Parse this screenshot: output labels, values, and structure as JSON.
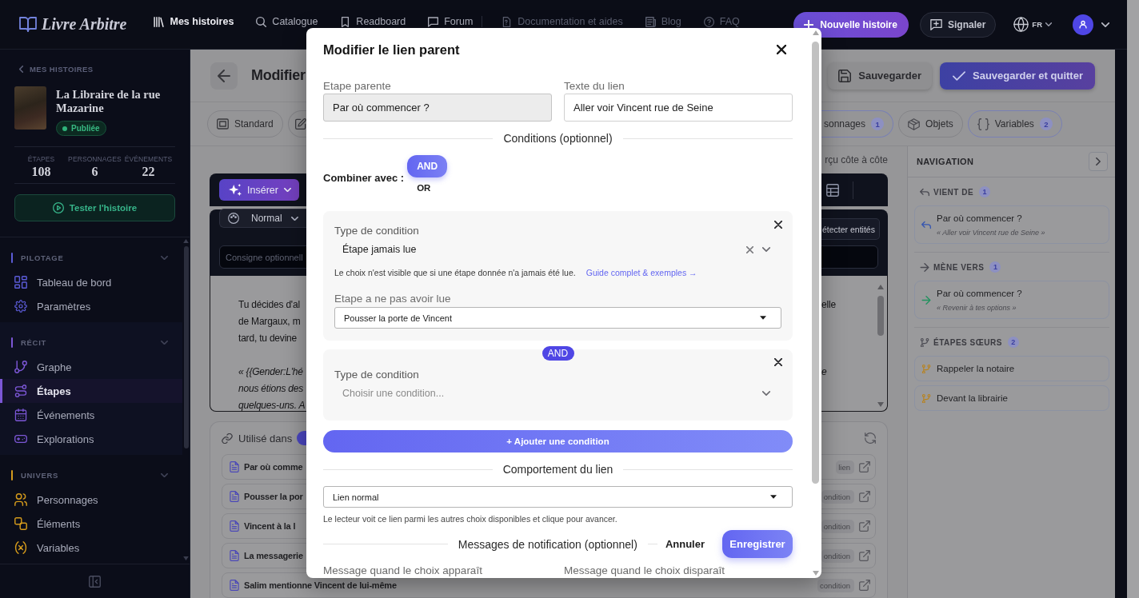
{
  "topbar": {
    "logo": "Livre Arbitre",
    "nav": [
      {
        "label": "Mes histoires",
        "kind": "main",
        "selected": true
      },
      {
        "label": "Catalogue",
        "kind": "main",
        "selected": false
      },
      {
        "label": "Readboard",
        "kind": "main",
        "selected": false
      },
      {
        "label": "Forum",
        "kind": "main",
        "selected": false
      },
      {
        "label": "Documentation et aides",
        "kind": "help",
        "selected": false
      },
      {
        "label": "Blog",
        "kind": "help",
        "selected": false
      },
      {
        "label": "FAQ",
        "kind": "help",
        "selected": false
      }
    ],
    "new_story_button": "Nouvelle histoire",
    "report_button": "Signaler",
    "language": "FR"
  },
  "sidebar": {
    "back_link": "MES HISTOIRES",
    "story_title": "La Libraire de la rue Mazarine",
    "status": "Publiée",
    "stats": [
      {
        "label": "ÉTAPES",
        "value": "108"
      },
      {
        "label": "PERSONNAGES",
        "value": "6"
      },
      {
        "label": "ÉVÉNEMENTS",
        "value": "22"
      }
    ],
    "test_button": "Tester l'histoire",
    "sections": [
      {
        "title": "PILOTAGE",
        "color": "#5b5bd6",
        "expanded": true,
        "items": [
          {
            "label": "Tableau de bord",
            "selected": false
          },
          {
            "label": "Paramètres",
            "selected": false
          }
        ]
      },
      {
        "title": "RÉCIT",
        "color": "#7c57d6",
        "expanded": true,
        "items": [
          {
            "label": "Graphe",
            "selected": false
          },
          {
            "label": "Étapes",
            "selected": true
          },
          {
            "label": "Événements",
            "selected": false
          },
          {
            "label": "Explorations",
            "selected": false
          }
        ]
      },
      {
        "title": "UNIVERS",
        "color": "#d49a1c",
        "expanded": true,
        "items": [
          {
            "label": "Personnages",
            "selected": false
          },
          {
            "label": "Éléments",
            "selected": false
          },
          {
            "label": "Variables",
            "selected": false
          }
        ]
      }
    ]
  },
  "page": {
    "title": "Modifier",
    "actions": [
      {
        "label": "Sauvegarder",
        "kind": "secondary"
      },
      {
        "label": "Sauvegarder et quitter",
        "kind": "primary"
      }
    ],
    "modes": [
      "Standard"
    ],
    "entity_tabs": [
      {
        "label": "sonnages",
        "count": "1",
        "highlighted": true
      },
      {
        "label": "Objets",
        "highlighted": false
      },
      {
        "label": "Variables",
        "count": "2",
        "highlighted": true
      }
    ],
    "preview_label": "rçu côte à côte",
    "insert_button": "Insérer",
    "style_menu": "Normal",
    "detect_button": "étecter entités",
    "prompt_placeholder": "Consigne optionnell",
    "editor_lines": [
      {
        "kind": "narration",
        "left": "Tu décides d'al",
        "right": "elle"
      },
      {
        "kind": "narration",
        "left": "de Margaux, m"
      },
      {
        "kind": "narration",
        "left": "tard, tu devine"
      },
      {
        "kind": "dialogue",
        "left": "« {{Gender:L'hé",
        "right": "e"
      },
      {
        "kind": "dialogue",
        "left": "nous étions des"
      },
      {
        "kind": "dialogue",
        "left": "quelques-uns. A"
      }
    ],
    "used_in": {
      "title": "Utilisé dans",
      "rows": [
        {
          "title": "Par où comme",
          "tag": "lien"
        },
        {
          "title": "Pousser la por",
          "tag": "ondition"
        },
        {
          "title": "Vincent à la l",
          "tag": "ondition"
        },
        {
          "title": "La messagerie",
          "tag": "ondition"
        },
        {
          "title": "Salim mentionne Vincent de lui-même",
          "tag": "condition"
        }
      ]
    }
  },
  "navigation": {
    "title": "NAVIGATION",
    "sections": [
      {
        "kind": "from",
        "title": "VIENT DE",
        "count": "1",
        "items": [
          {
            "title": "Par où commencer ?",
            "quote": "« Aller voir Vincent rue de Seine »"
          }
        ]
      },
      {
        "kind": "to",
        "title": "MÈNE VERS",
        "count": "1",
        "items": [
          {
            "title": "Par où commencer ?",
            "quote": "« Revenir à tes options »"
          }
        ]
      },
      {
        "kind": "sibling",
        "title": "ÉTAPES SŒURS",
        "count": "2",
        "items": [
          {
            "title": "Rappeler la notaire"
          },
          {
            "title": "Devant la librairie"
          }
        ]
      }
    ]
  },
  "modal": {
    "title": "Modifier le lien parent",
    "fields": [
      {
        "label": "Etape parente",
        "value": "Par où commencer ?",
        "readonly": true
      },
      {
        "label": "Texte du lien",
        "value": "Aller voir Vincent rue de Seine",
        "readonly": false
      }
    ],
    "conditions_heading": "Conditions (optionnel)",
    "combine_label": "Combiner avec :",
    "combine_options": [
      {
        "label": "AND",
        "selected": true
      },
      {
        "label": "OR",
        "selected": false
      }
    ],
    "conditions": [
      {
        "type_label": "Type de condition",
        "value": "Étape jamais lue",
        "help": "Le choix n'est visible que si une étape donnée n'a jamais été lue.",
        "help_link": "Guide complet & exemples →",
        "step_label": "Etape a ne pas avoir lue",
        "step_value": "Pousser la porte de Vincent"
      },
      {
        "connector": "AND",
        "type_label": "Type de condition",
        "placeholder": "Choisir une condition..."
      }
    ],
    "add_condition_button": "+ Ajouter une condition",
    "behavior_heading": "Comportement du lien",
    "behavior_value": "Lien normal",
    "behavior_help": "Le lecteur voit ce lien parmi les autres choix disponibles et clique pour avancer.",
    "notifications_heading": "Messages de notification (optionnel)",
    "message_labels": [
      "Message quand le choix apparaît",
      "Message quand le choix disparaît"
    ],
    "cancel_button": "Annuler",
    "save_button": "Enregistrer"
  }
}
